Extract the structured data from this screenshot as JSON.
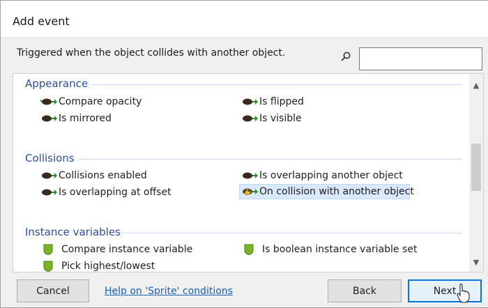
{
  "window": {
    "title": "Add event"
  },
  "description": "Triggered when the object collides with another object.",
  "search": {
    "value": "",
    "placeholder": ""
  },
  "groups": [
    {
      "title": "Appearance",
      "items": [
        {
          "label": "Compare opacity",
          "icon": "condition-icon"
        },
        {
          "label": "Is flipped",
          "icon": "condition-icon"
        },
        {
          "label": "Is mirrored",
          "icon": "condition-icon"
        },
        {
          "label": "Is visible",
          "icon": "condition-icon"
        }
      ]
    },
    {
      "title": "Collisions",
      "items": [
        {
          "label": "Collisions enabled",
          "icon": "condition-icon"
        },
        {
          "label": "Is overlapping another object",
          "icon": "condition-icon"
        },
        {
          "label": "Is overlapping at offset",
          "icon": "condition-icon"
        },
        {
          "label": "On collision with another object",
          "icon": "trigger-icon",
          "selected": true
        }
      ]
    },
    {
      "title": "Instance variables",
      "items": [
        {
          "label": "Compare instance variable",
          "icon": "shield-icon"
        },
        {
          "label": "Is boolean instance variable set",
          "icon": "shield-icon"
        },
        {
          "label": "Pick highest/lowest",
          "icon": "shield-icon"
        }
      ]
    }
  ],
  "buttons": {
    "cancel": "Cancel",
    "help": "Help on 'Sprite' conditions",
    "back": "Back",
    "next": "Next"
  },
  "colors": {
    "group_title": "#2a4e9a",
    "selection": "#d9e8fa",
    "link": "#1a5fb4",
    "primary_border": "#0078d7"
  }
}
